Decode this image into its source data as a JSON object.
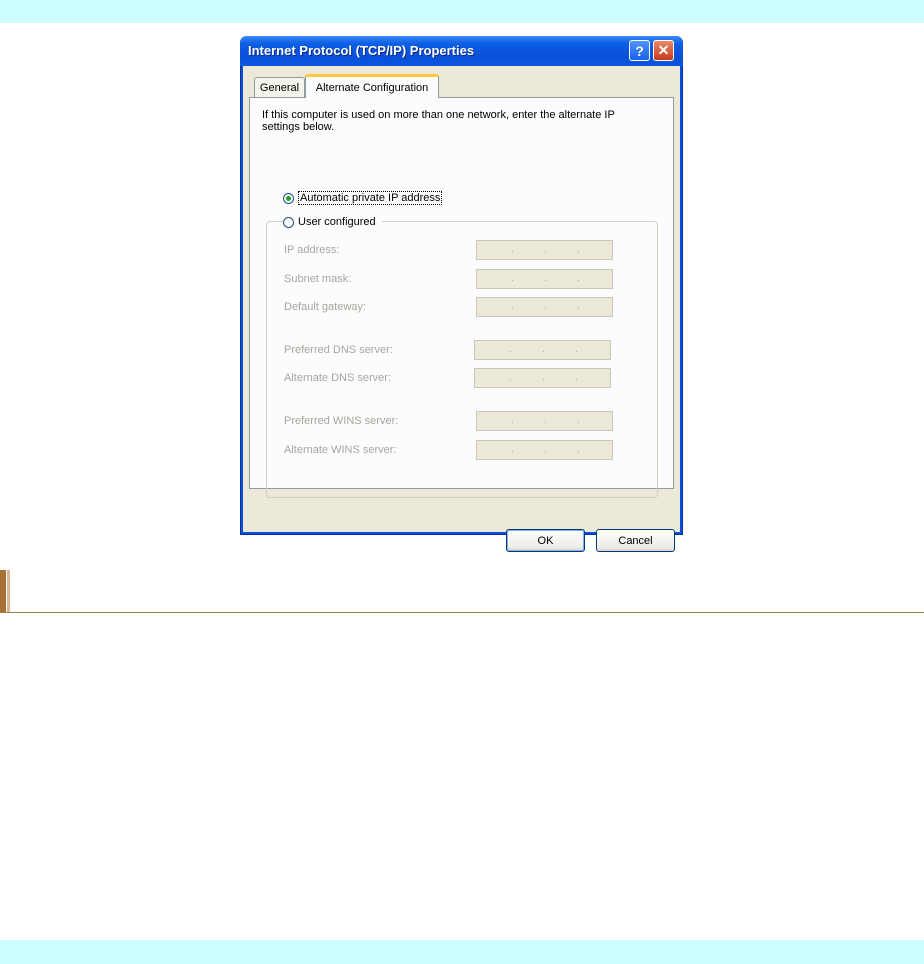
{
  "dialog": {
    "title": "Internet Protocol (TCP/IP) Properties",
    "help_glyph": "?",
    "close_glyph": "✕",
    "tabs": [
      {
        "label": "General"
      },
      {
        "label": "Alternate Configuration",
        "selected": true
      }
    ],
    "description": "If this computer is used on more than one network, enter the alternate IP settings below.",
    "options": [
      {
        "label": "Automatic private IP address",
        "checked": true
      },
      {
        "label": "User configured",
        "checked": false
      }
    ],
    "fields": [
      {
        "label": "IP address:",
        "value": ""
      },
      {
        "label": "Subnet mask:",
        "value": ""
      },
      {
        "label": "Default gateway:",
        "value": ""
      },
      {
        "label": "Preferred DNS server:",
        "value": ""
      },
      {
        "label": "Alternate DNS server:",
        "value": ""
      },
      {
        "label": "Preferred WINS server:",
        "value": ""
      },
      {
        "label": "Alternate WINS server:",
        "value": ""
      }
    ],
    "ok_label": "OK",
    "cancel_label": "Cancel",
    "ip_dot": "."
  },
  "colors": {
    "band": "#ccfcff",
    "title_bar": "#0a4fd8",
    "dialog_face": "#ece9d8",
    "heading_accent": "#a96f34"
  }
}
